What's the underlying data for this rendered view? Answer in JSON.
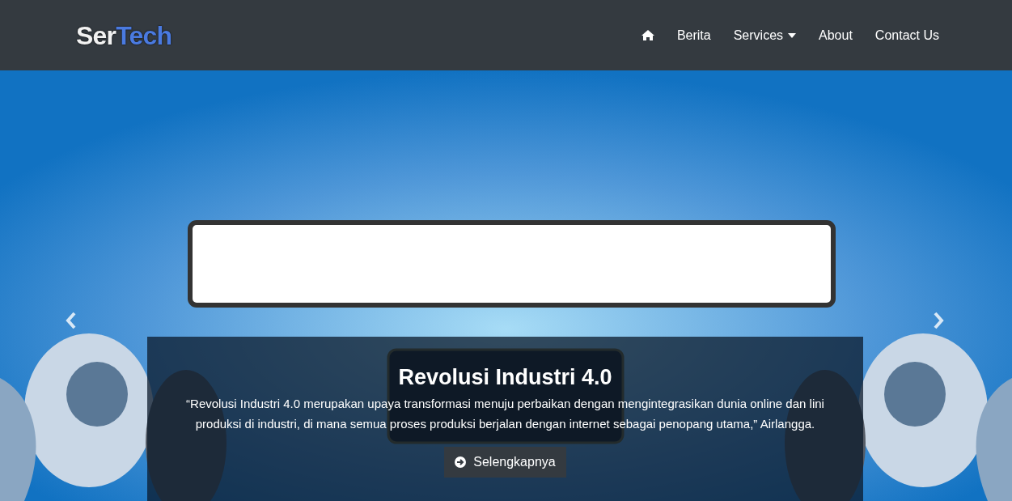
{
  "brand": {
    "first": "Ser",
    "second": "Tech"
  },
  "nav": [
    {
      "kind": "home"
    },
    {
      "kind": "link",
      "label": "Berita"
    },
    {
      "kind": "dropdown",
      "label": "Services"
    },
    {
      "kind": "link",
      "label": "About"
    },
    {
      "kind": "link",
      "label": "Contact Us"
    }
  ],
  "hero": {
    "kind": "picture",
    "caption": {
      "title": "Revolusi Industri 4.0",
      "text": "“Revolusi Industri 4.0 merupakan upaya transformasi menuju perbaikan dengan mengintegrasikan dunia online dan lini produksi di industri, di mana semua proses produksi berjalan dengan internet sebagai penopang utama,” Airlangga.",
      "button": "Selengkapnya"
    }
  }
}
